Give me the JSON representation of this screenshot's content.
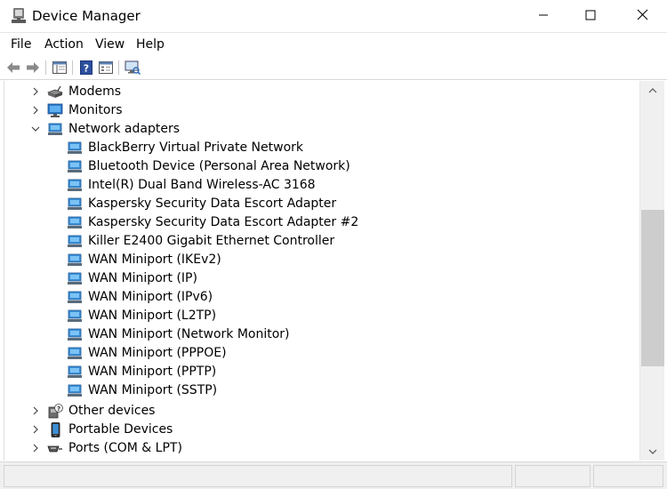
{
  "window": {
    "title": "Device Manager",
    "icons": [
      "device-manager-icon",
      "minimize-icon",
      "maximize-icon",
      "close-icon"
    ]
  },
  "menu": [
    "File",
    "Action",
    "View",
    "Help"
  ],
  "toolbar": {
    "icons": [
      "back-arrow-icon",
      "forward-arrow-icon",
      "show-hide-console-tree-icon",
      "help-icon",
      "properties-icon",
      "scan-hardware-changes-icon"
    ]
  },
  "tree": {
    "categories": [
      {
        "label": "Modems",
        "expanded": false,
        "icon": "modem-icon"
      },
      {
        "label": "Monitors",
        "expanded": false,
        "icon": "monitor-icon"
      },
      {
        "label": "Network adapters",
        "expanded": true,
        "icon": "network-adapter-icon"
      }
    ],
    "network_adapters": [
      "BlackBerry Virtual Private Network",
      "Bluetooth Device (Personal Area Network)",
      "Intel(R) Dual Band Wireless-AC 3168",
      "Kaspersky Security Data Escort Adapter",
      "Kaspersky Security Data Escort Adapter #2",
      "Killer E2400 Gigabit Ethernet Controller",
      "WAN Miniport (IKEv2)",
      "WAN Miniport (IP)",
      "WAN Miniport (IPv6)",
      "WAN Miniport (L2TP)",
      "WAN Miniport (Network Monitor)",
      "WAN Miniport (PPPOE)",
      "WAN Miniport (PPTP)",
      "WAN Miniport (SSTP)"
    ],
    "categories_after": [
      {
        "label": "Other devices",
        "expanded": false,
        "icon": "unknown-device-icon"
      },
      {
        "label": "Portable Devices",
        "expanded": false,
        "icon": "portable-device-icon"
      },
      {
        "label": "Ports (COM & LPT)",
        "expanded": false,
        "icon": "port-icon"
      }
    ]
  },
  "colors": {
    "accent_network": "#3d8fd6",
    "window_bg": "#ffffff",
    "chrome_bg": "#f0f0f0"
  }
}
